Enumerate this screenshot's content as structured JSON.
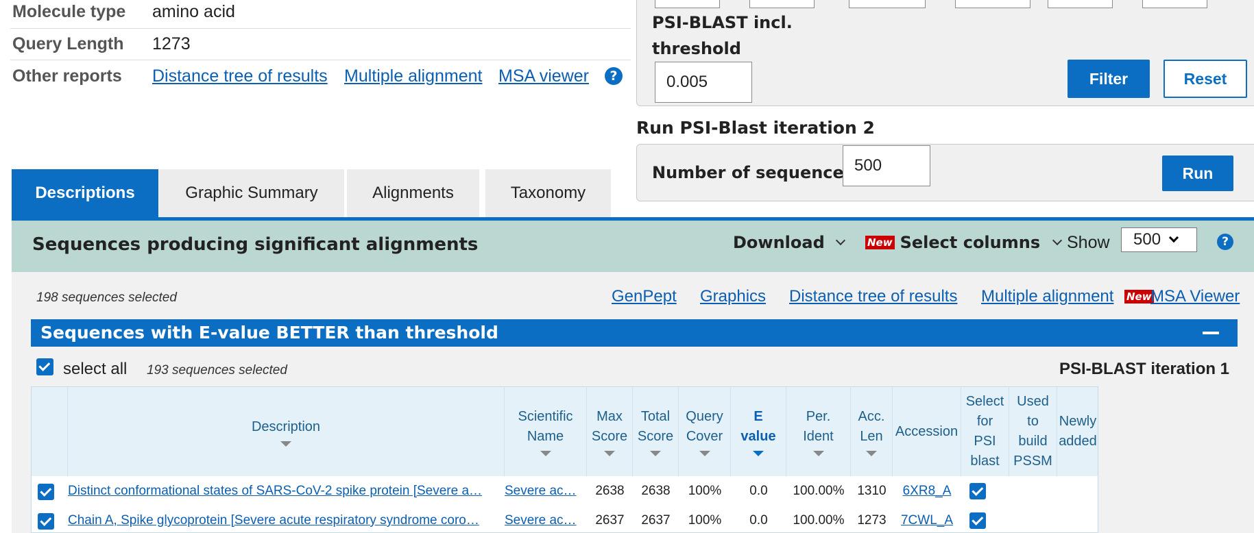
{
  "info": {
    "molecule_type_label": "Molecule type",
    "molecule_type_value": "amino acid",
    "query_length_label": "Query Length",
    "query_length_value": "1273",
    "other_reports_label": "Other reports",
    "reports": [
      "Distance tree of results",
      "Multiple alignment",
      "MSA viewer"
    ],
    "help_icon": "question-circle-icon"
  },
  "filter": {
    "psi_threshold_label_1": "PSI-BLAST incl.",
    "psi_threshold_label_2": "threshold",
    "psi_threshold_value": "0.005",
    "filter_button": "Filter",
    "reset_button": "Reset"
  },
  "run": {
    "title": "Run PSI-Blast iteration 2",
    "num_sequences_label": "Number of sequences",
    "num_sequences_value": "500",
    "run_button": "Run"
  },
  "tabs": [
    "Descriptions",
    "Graphic Summary",
    "Alignments",
    "Taxonomy"
  ],
  "results_header": {
    "title": "Sequences producing significant alignments",
    "download": "Download",
    "new_badge": "New",
    "select_columns": "Select columns",
    "show_label": "Show",
    "show_value": "500"
  },
  "selection": {
    "count_text": "198 sequences selected",
    "links": [
      "GenPept",
      "Graphics",
      "Distance tree of results",
      "Multiple alignment"
    ],
    "msa_link": "MSA Viewer",
    "new_badge": "New"
  },
  "group": {
    "title": "Sequences with E-value BETTER than threshold",
    "collapse_icon": "minus-icon",
    "select_all": "select all",
    "group_count": "193 sequences selected",
    "iteration": "PSI-BLAST iteration 1"
  },
  "table": {
    "headers": {
      "description": "Description",
      "sci1": "Scientific",
      "sci2": "Name",
      "max1": "Max",
      "max2": "Score",
      "total1": "Total",
      "total2": "Score",
      "qc1": "Query",
      "qc2": "Cover",
      "e1": "E",
      "e2": "value",
      "pi1": "Per.",
      "pi2": "Ident",
      "acc1": "Acc.",
      "acc2": "Len",
      "accession": "Accession",
      "sel1": "Select",
      "sel2": "for",
      "sel3": "PSI",
      "sel4": "blast",
      "used1": "Used",
      "used2": "to",
      "used3": "build",
      "used4": "PSSM",
      "new1": "Newly",
      "new2": "added"
    },
    "rows": [
      {
        "description": "Distinct conformational states of SARS-CoV-2 spike protein [Severe a…",
        "scientific_name": "Severe ac…",
        "max_score": "2638",
        "total_score": "2638",
        "query_cover": "100%",
        "e_value": "0.0",
        "per_ident": "100.00%",
        "acc_len": "1310",
        "accession": "6XR8_A"
      },
      {
        "description": "Chain A, Spike glycoprotein [Severe acute respiratory syndrome coro…",
        "scientific_name": "Severe ac…",
        "max_score": "2637",
        "total_score": "2637",
        "query_cover": "100%",
        "e_value": "0.0",
        "per_ident": "100.00%",
        "acc_len": "1273",
        "accession": "7CWL_A"
      }
    ]
  },
  "colors": {
    "accent": "#0b6ec2",
    "teal_header": "#bad7d2",
    "table_header_bg": "#e4f1f8",
    "link": "#0b5eb0",
    "new_badge": "#cc0000"
  }
}
